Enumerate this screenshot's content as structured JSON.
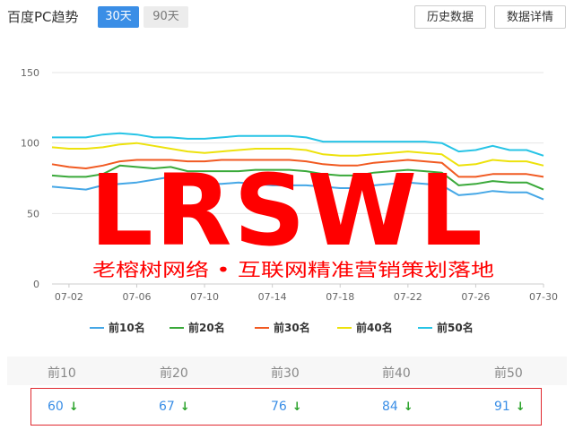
{
  "header": {
    "title": "百度PC趋势",
    "tab_active": "30天",
    "tab_inactive": "90天",
    "btn_history": "历史数据",
    "btn_detail": "数据详情"
  },
  "watermark": {
    "logo": "LRSWL",
    "slogan": "老榕树网络 • 互联网精准营销策划落地",
    "color": "#ff0000"
  },
  "chart_data": {
    "type": "line",
    "ylim": [
      0,
      150
    ],
    "yticks": [
      0,
      50,
      100,
      150
    ],
    "x": [
      "07-01",
      "07-02",
      "07-03",
      "07-04",
      "07-05",
      "07-06",
      "07-07",
      "07-08",
      "07-09",
      "07-10",
      "07-11",
      "07-12",
      "07-13",
      "07-14",
      "07-15",
      "07-16",
      "07-17",
      "07-18",
      "07-19",
      "07-20",
      "07-21",
      "07-22",
      "07-23",
      "07-24",
      "07-25",
      "07-26",
      "07-27",
      "07-28",
      "07-29",
      "07-30"
    ],
    "xticks": [
      "07-02",
      "07-06",
      "07-10",
      "07-14",
      "07-18",
      "07-22",
      "07-26",
      "07-30"
    ],
    "grid": true,
    "legend": "bottom",
    "series": [
      {
        "name": "前10名",
        "color": "#45a7e6",
        "values": [
          69,
          68,
          67,
          70,
          71,
          72,
          74,
          76,
          72,
          71,
          71,
          72,
          71,
          70,
          70,
          70,
          69,
          68,
          68,
          70,
          71,
          72,
          71,
          70,
          63,
          64,
          66,
          65,
          65,
          60
        ]
      },
      {
        "name": "前20名",
        "color": "#3aa93a",
        "values": [
          77,
          76,
          76,
          78,
          84,
          83,
          82,
          83,
          80,
          80,
          80,
          80,
          81,
          81,
          81,
          80,
          78,
          77,
          77,
          79,
          80,
          81,
          80,
          79,
          70,
          71,
          73,
          72,
          72,
          67
        ]
      },
      {
        "name": "前30名",
        "color": "#f15a22",
        "values": [
          85,
          83,
          82,
          84,
          87,
          88,
          88,
          88,
          87,
          87,
          88,
          88,
          88,
          88,
          88,
          87,
          85,
          84,
          84,
          86,
          87,
          88,
          87,
          86,
          76,
          76,
          78,
          78,
          78,
          76
        ]
      },
      {
        "name": "前40名",
        "color": "#ede20c",
        "values": [
          97,
          96,
          96,
          97,
          99,
          100,
          98,
          96,
          94,
          93,
          94,
          95,
          96,
          96,
          96,
          95,
          92,
          91,
          91,
          92,
          93,
          94,
          93,
          92,
          84,
          85,
          88,
          87,
          87,
          84
        ]
      },
      {
        "name": "前50名",
        "color": "#27c4e6",
        "values": [
          104,
          104,
          104,
          106,
          107,
          106,
          104,
          104,
          103,
          103,
          104,
          105,
          105,
          105,
          105,
          104,
          101,
          101,
          101,
          101,
          101,
          101,
          101,
          100,
          94,
          95,
          98,
          95,
          95,
          91
        ]
      }
    ]
  },
  "stats": {
    "headers": [
      "前10",
      "前20",
      "前30",
      "前40",
      "前50"
    ],
    "values": [
      "60",
      "67",
      "76",
      "84",
      "91"
    ],
    "arrow": "↓"
  }
}
